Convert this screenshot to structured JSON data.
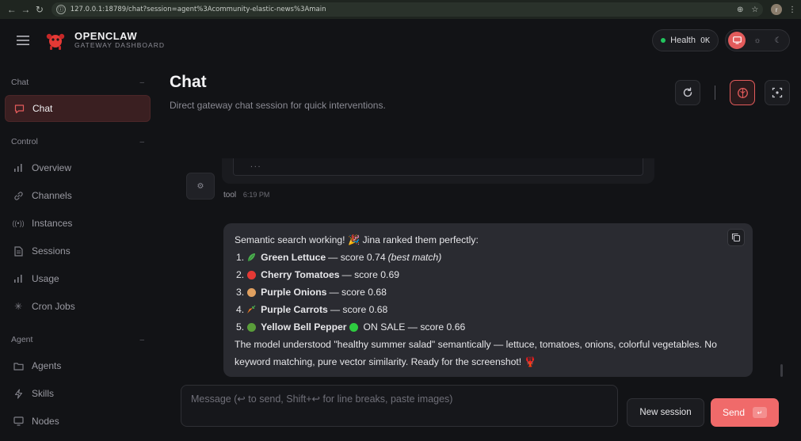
{
  "browser": {
    "url": "127.0.0.1:18789/chat?session=agent%3Acommunity-elastic-news%3Amain",
    "profile_initial": "r"
  },
  "app": {
    "title": "OPENCLAW",
    "subtitle": "GATEWAY DASHBOARD",
    "health_label": "Health",
    "health_value": "OK",
    "health_color": "#22c55e",
    "accent_color": "#e35b5b"
  },
  "sidebar": {
    "sections": [
      {
        "label": "Chat",
        "items": [
          {
            "label": "Chat",
            "icon": "message-square-icon",
            "active": true
          }
        ]
      },
      {
        "label": "Control",
        "items": [
          {
            "label": "Overview",
            "icon": "bar-chart-icon"
          },
          {
            "label": "Channels",
            "icon": "link-icon"
          },
          {
            "label": "Instances",
            "icon": "radio-icon"
          },
          {
            "label": "Sessions",
            "icon": "document-icon"
          },
          {
            "label": "Usage",
            "icon": "bar-chart-icon"
          },
          {
            "label": "Cron Jobs",
            "icon": "loader-icon"
          }
        ]
      },
      {
        "label": "Agent",
        "items": [
          {
            "label": "Agents",
            "icon": "folder-icon"
          },
          {
            "label": "Skills",
            "icon": "zap-icon"
          },
          {
            "label": "Nodes",
            "icon": "monitor-icon"
          }
        ]
      }
    ]
  },
  "page": {
    "title": "Chat",
    "subtitle": "Direct gateway chat session for quick interventions."
  },
  "messages": {
    "tool_fragment_text": "...",
    "tool_author": "tool",
    "tool_time": "6:19 PM",
    "assistant": {
      "intro_text": "Semantic search working!",
      "intro_after": "Jina ranked them perfectly:",
      "results": [
        {
          "num": "1.",
          "name": "Green Lettuce",
          "score": "— score 0.74",
          "note": "(best match)",
          "emoji_color": "#4caf50"
        },
        {
          "num": "2.",
          "name": "Cherry Tomatoes",
          "score": "— score 0.69",
          "note": "",
          "emoji_color": "#e53935"
        },
        {
          "num": "3.",
          "name": "Purple Onions",
          "score": "— score 0.68",
          "note": "",
          "emoji_color": "#e0a060"
        },
        {
          "num": "4.",
          "name": "Purple Carrots",
          "score": "— score 0.68",
          "note": "",
          "emoji_color": "#f07b22"
        },
        {
          "num": "5.",
          "name": "Yellow Bell Pepper",
          "score": "ON SALE — score 0.66",
          "note": "",
          "emoji_color": "#5a9e3a",
          "badge_color": "#2ecc40"
        }
      ],
      "closing_text": "The model understood \"healthy summer salad\" semantically — lettuce, tomatoes, onions, colorful vegetables. No keyword matching, pure vector similarity. Ready for the screenshot!"
    }
  },
  "composer": {
    "placeholder": "Message (↩ to send, Shift+↩ for line breaks, paste images)",
    "new_session_label": "New session",
    "send_label": "Send",
    "send_kbd": "↵"
  }
}
